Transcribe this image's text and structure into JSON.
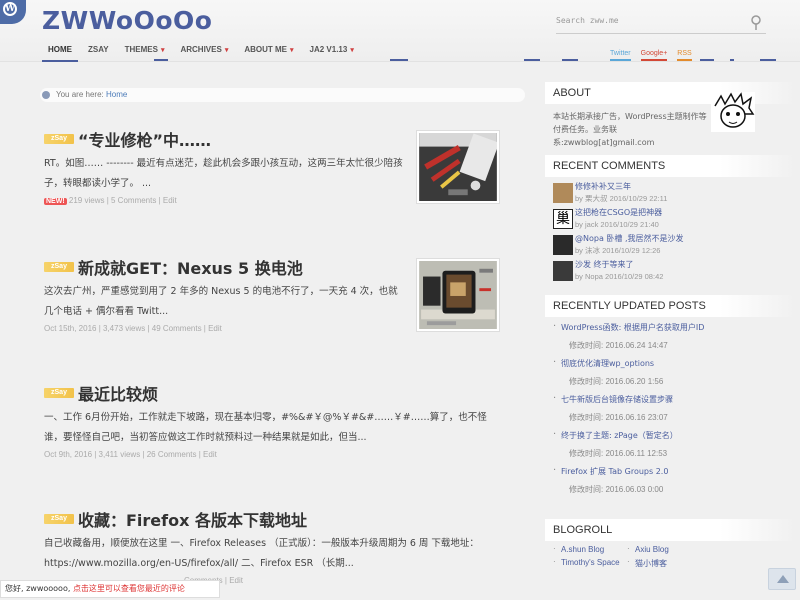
{
  "site": {
    "title": "ZWWoOoOo",
    "search_placeholder": "Search zww.me"
  },
  "nav": {
    "items": [
      {
        "label": "HOME",
        "has_caret": false
      },
      {
        "label": "ZSAY",
        "has_caret": false
      },
      {
        "label": "THEMES",
        "has_caret": true
      },
      {
        "label": "ARCHIVES",
        "has_caret": true
      },
      {
        "label": "ABOUT ME",
        "has_caret": true
      },
      {
        "label": "JA2 V1.13",
        "has_caret": true
      }
    ],
    "social": [
      "Twitter",
      "Google+",
      "RSS"
    ]
  },
  "breadcrumb": {
    "prefix": "You are here:",
    "link": "Home"
  },
  "posts": [
    {
      "badge": "zSay",
      "title": "“专业修枪”中……",
      "excerpt": "RT。如图…… -------- 最近有点迷茫，趁此机会多跟小孩互动，这两三年太忙很少陪孩子，转眼都读小学了。 ...",
      "new_badge": "NEW!",
      "meta": "219 views | 5 Comments | Edit",
      "thumb": "gun-parts"
    },
    {
      "badge": "zSay",
      "title": "新成就GET：Nexus 5 换电池",
      "excerpt": "这次去广州，严重感觉到用了 2 年多的 Nexus 5 的电池不行了，一天充 4 次，也就几个电话 + 偶尔看看 Twitt...",
      "meta": "Oct 15th, 2016 | 3,473 views | 49 Comments | Edit",
      "thumb": "phone-repair"
    },
    {
      "badge": "zSay",
      "title": "最近比较烦",
      "excerpt": "一、工作 6月份开始，工作就走下坡路，现在基本归零，#%&#￥@%￥#&#……￥#……算了，也不怪谁，要怪怪自己吧，当初答应做这工作时就预料过一种结果就是如此，但当...",
      "meta": "Oct 9th, 2016 | 3,411 views | 26 Comments | Edit"
    },
    {
      "badge": "zSay",
      "title": "收藏：Firefox 各版本下载地址",
      "excerpt": "自己收藏备用，顺便放在这里 一、Firefox Releases （正式版）：一般版本升级周期为 6 周 下载地址：https://www.mozilla.org/en-US/firefox/all/ 二、Firefox ESR （长期...",
      "meta": "Comments | Edit"
    }
  ],
  "sidebar": {
    "about": {
      "title": "ABOUT",
      "text": "本站长期承接广告，WordPress主题制作等付费任务。业务联系:zwwblog[at]gmail.com"
    },
    "recent_comments": {
      "title": "RECENT COMMENTS",
      "items": [
        {
          "title": "修修补补又三年",
          "meta": "by 栗大叔 2016/10/29 22:11"
        },
        {
          "title": "这把枪在CSGO是把神器",
          "meta": "by jack 2016/10/29 21:40"
        },
        {
          "title": "@Nopa 卧槽 ,我居然不是沙发",
          "meta": "by 沫冰 2016/10/29 12:26"
        },
        {
          "title": "沙发 终于等来了",
          "meta": "by Nopa 2016/10/29 08:42"
        }
      ]
    },
    "updated_posts": {
      "title": "RECENTLY UPDATED POSTS",
      "items": [
        {
          "title": "WordPress函数: 根据用户名获取用户ID",
          "time": "修改时间: 2016.06.24 14:47"
        },
        {
          "title": "彻底优化清理wp_options",
          "time": "修改时间: 2016.06.20 1:56"
        },
        {
          "title": "七牛新版后台镜像存储设置步骤",
          "time": "修改时间: 2016.06.16 23:07"
        },
        {
          "title": "终于换了主题: zPage（暂定名）",
          "time": "修改时间: 2016.06.11 12:53"
        },
        {
          "title": "Firefox 扩展 Tab Groups 2.0",
          "time": "修改时间: 2016.06.03 0:00"
        }
      ]
    },
    "blogroll": {
      "title": "BLOGROLL",
      "items": [
        "A.shun Blog",
        "Axiu Blog",
        "Timothy's Space",
        "猫小博客"
      ]
    }
  },
  "notice": {
    "greeting": "您好, zwwooooo, ",
    "link": "点击这里可以查看您最近的评论"
  },
  "colors": {
    "brand": "#4b5e9e",
    "badge": "#f2c24a",
    "link": "#4b7bb8"
  }
}
